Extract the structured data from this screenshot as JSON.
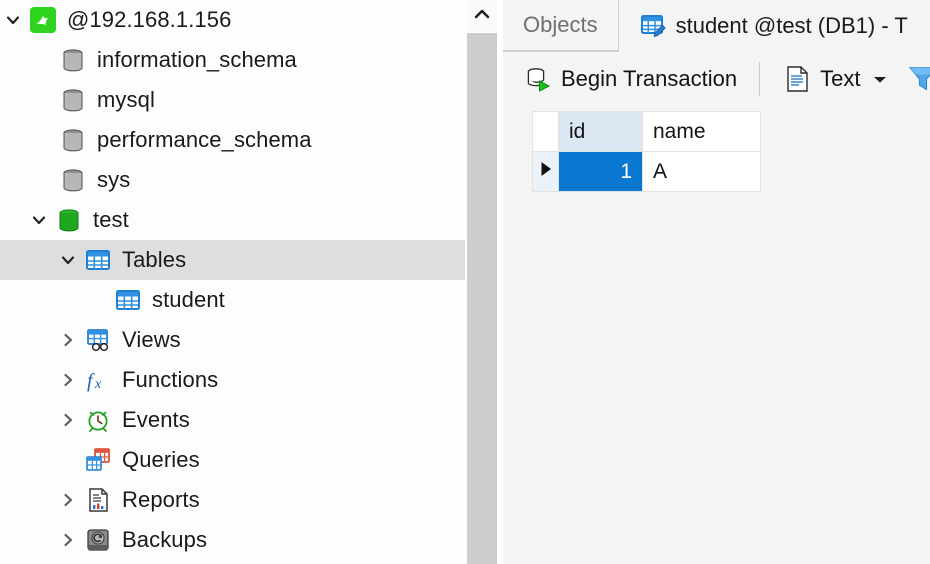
{
  "navigator": {
    "tree": [
      {
        "id": "connection",
        "label": "@192.168.1.156",
        "icon": "mysql-dolphin-icon",
        "indent": 0,
        "twisty": "expanded",
        "selected": false
      },
      {
        "id": "information_schema",
        "label": "information_schema",
        "icon": "database-gray-icon",
        "indent": 1,
        "twisty": "none",
        "selected": false
      },
      {
        "id": "mysql",
        "label": "mysql",
        "icon": "database-gray-icon",
        "indent": 1,
        "twisty": "none",
        "selected": false
      },
      {
        "id": "performance_schema",
        "label": "performance_schema",
        "icon": "database-gray-icon",
        "indent": 1,
        "twisty": "none",
        "selected": false
      },
      {
        "id": "sys",
        "label": "sys",
        "icon": "database-gray-icon",
        "indent": 1,
        "twisty": "none",
        "selected": false
      },
      {
        "id": "test",
        "label": "test",
        "icon": "database-green-icon",
        "indent": 1,
        "twisty": "expanded",
        "selected": false
      },
      {
        "id": "tables",
        "label": "Tables",
        "icon": "table-blue-icon",
        "indent": 2,
        "twisty": "expanded",
        "selected": true
      },
      {
        "id": "student",
        "label": "student",
        "icon": "table-blue-icon",
        "indent": 3,
        "twisty": "none",
        "selected": false
      },
      {
        "id": "views",
        "label": "Views",
        "icon": "views-icon",
        "indent": 2,
        "twisty": "collapsed",
        "selected": false
      },
      {
        "id": "functions",
        "label": "Functions",
        "icon": "function-fx-icon",
        "indent": 2,
        "twisty": "collapsed",
        "selected": false
      },
      {
        "id": "events",
        "label": "Events",
        "icon": "clock-icon",
        "indent": 2,
        "twisty": "collapsed",
        "selected": false
      },
      {
        "id": "queries",
        "label": "Queries",
        "icon": "queries-icon",
        "indent": 2,
        "twisty": "none",
        "selected": false
      },
      {
        "id": "reports",
        "label": "Reports",
        "icon": "report-document-icon",
        "indent": 2,
        "twisty": "collapsed",
        "selected": false
      },
      {
        "id": "backups",
        "label": "Backups",
        "icon": "backup-disk-icon",
        "indent": 2,
        "twisty": "collapsed",
        "selected": false
      }
    ]
  },
  "splitter": {
    "scroll_up_icon": "chevron-up-icon"
  },
  "editor": {
    "tabs": [
      {
        "id": "objects",
        "label": "Objects",
        "icon": null,
        "active": false
      },
      {
        "id": "student-table",
        "label": "student @test (DB1) - T",
        "icon": "table-edit-icon",
        "active": true
      }
    ],
    "toolbar": {
      "begin_transaction": {
        "label": "Begin Transaction",
        "icon": "database-play-icon"
      },
      "text": {
        "label": "Text",
        "icon": "text-document-icon",
        "caret": "chevron-down-icon"
      },
      "filter": {
        "label": "",
        "icon": "filter-funnel-icon"
      }
    },
    "grid": {
      "columns": [
        "id",
        "name"
      ],
      "selected_column": "id",
      "rows": [
        {
          "indicator": "current-row-arrow",
          "id": "1",
          "name": "A"
        }
      ],
      "selected_cell": {
        "row": 0,
        "column": "id"
      }
    }
  },
  "colors": {
    "selection_blue": "#0a78d0",
    "header_selected": "#dbe8f4",
    "tree_selected": "#dedede",
    "toolbar_bg": "#f4f4f4",
    "scrollbar_thumb": "#cdcdcd",
    "mysql_green": "#33cc33",
    "db_green": "#16a016"
  }
}
